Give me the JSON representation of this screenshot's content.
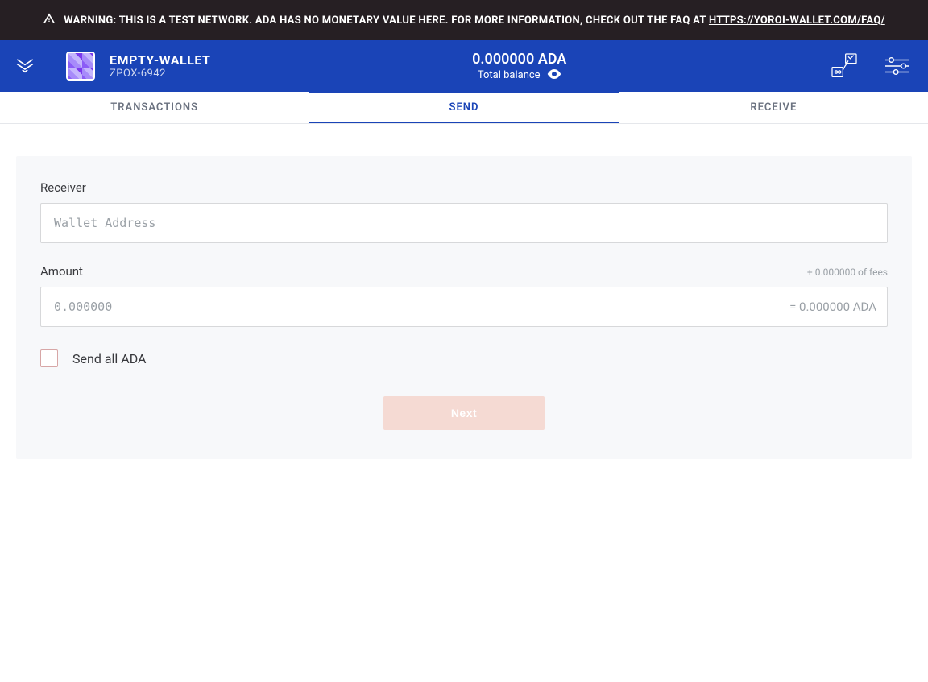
{
  "banner": {
    "prefix": "WARNING: THIS IS A TEST NETWORK. ADA HAS NO MONETARY VALUE HERE. FOR MORE INFORMATION, CHECK OUT THE FAQ AT ",
    "link_text": "HTTPS://YOROI-WALLET.COM/FAQ/"
  },
  "header": {
    "wallet_name": "EMPTY-WALLET",
    "wallet_sub": "ZPOX-6942",
    "balance": "0.000000 ADA",
    "balance_label": "Total balance"
  },
  "tabs": {
    "transactions": "TRANSACTIONS",
    "send": "SEND",
    "receive": "RECEIVE",
    "active": "send"
  },
  "form": {
    "receiver_label": "Receiver",
    "receiver_placeholder": "Wallet Address",
    "amount_label": "Amount",
    "fees_note": "+ 0.000000 of fees",
    "amount_placeholder": "0.000000",
    "amount_eq": "= 0.000000 ADA",
    "send_all_label": "Send all ADA",
    "next_label": "Next"
  },
  "colors": {
    "brand": "#1A44B7",
    "banner_bg": "#261F23",
    "disabled_btn": "#f5dad3"
  }
}
